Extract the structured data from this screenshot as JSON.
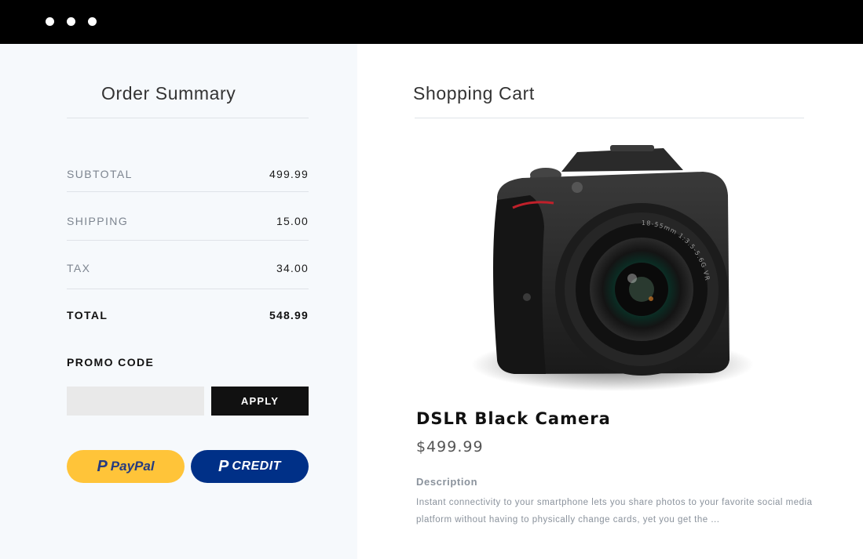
{
  "window": {
    "controls": [
      "window-dot",
      "window-dot",
      "window-dot"
    ]
  },
  "order_summary": {
    "title": "Order Summary",
    "rows": [
      {
        "label": "SUBTOTAL",
        "value": "499.99"
      },
      {
        "label": "SHIPPING",
        "value": "15.00"
      },
      {
        "label": "TAX",
        "value": "34.00"
      },
      {
        "label": "TOTAL",
        "value": "548.99"
      }
    ],
    "promo": {
      "label": "PROMO CODE",
      "value": "",
      "apply_label": "APPLY"
    },
    "payment": {
      "paypal_brand": "PayPal",
      "credit_label": "CREDIT",
      "paypal_color": "#ffc439",
      "credit_color": "#003087"
    }
  },
  "cart": {
    "title": "Shopping Cart",
    "product": {
      "image": "dslr-camera-image",
      "lens_text": "18-55mm 1:3.5-5.6G VR",
      "name": "DSLR Black Camera",
      "price": "$499.99",
      "description_title": "Description",
      "description": "Instant connectivity to your smartphone lets you share photos to your favorite social media platform without having to physically change cards, yet you get the ..."
    }
  }
}
